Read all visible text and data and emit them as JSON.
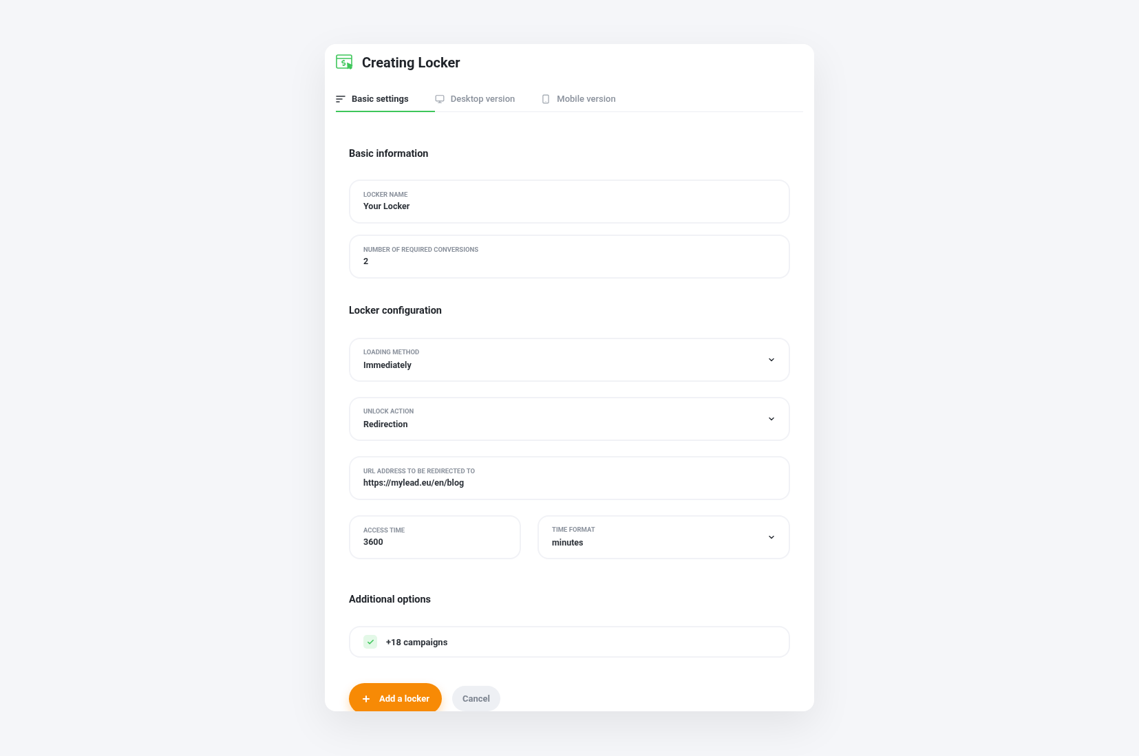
{
  "window": {
    "title": "Creating Locker"
  },
  "tabs": [
    {
      "label": "Basic settings",
      "kind": "settings",
      "selected": true
    },
    {
      "label": "Desktop version",
      "kind": "desktop",
      "selected": false
    },
    {
      "label": "Mobile version",
      "kind": "mobile",
      "selected": false
    }
  ],
  "sections": [
    {
      "title": "Basic information",
      "rows": [
        [
          {
            "kind": "text",
            "label": "LOCKER NAME",
            "value": "Your Locker"
          }
        ],
        [
          {
            "kind": "text",
            "label": "NUMBER OF REQUIRED CONVERSIONS",
            "value": "2"
          }
        ]
      ]
    },
    {
      "title": "Locker configuration",
      "rows": [
        [
          {
            "kind": "select",
            "label": "LOADING METHOD",
            "value": "Immediately"
          }
        ],
        [
          {
            "kind": "select",
            "label": "UNLOCK ACTION",
            "value": "Redirection"
          }
        ],
        [
          {
            "kind": "text",
            "label": "URL ADDRESS TO BE REDIRECTED TO",
            "value": "https://mylead.eu/en/blog"
          }
        ],
        [
          {
            "kind": "text",
            "label": "ACCESS TIME",
            "value": "3600"
          },
          {
            "kind": "select",
            "label": "TIME FORMAT",
            "value": "minutes"
          }
        ]
      ]
    },
    {
      "title": "Additional options",
      "options": [
        {
          "label": "+18 campaigns",
          "checked": true
        }
      ]
    }
  ],
  "buttons": [
    {
      "kind": "primary",
      "label": "Add a locker"
    },
    {
      "kind": "secondary",
      "label": "Cancel"
    }
  ]
}
